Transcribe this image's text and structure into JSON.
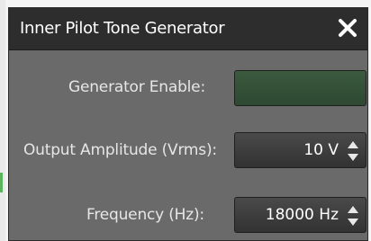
{
  "dialog": {
    "title": "Inner Pilot Tone Generator"
  },
  "fields": {
    "generator_enable": {
      "label": "Generator Enable:"
    },
    "output_amplitude": {
      "label": "Output Amplitude (Vrms):",
      "value": "10 V"
    },
    "frequency": {
      "label": "Frequency (Hz):",
      "value": "18000 Hz"
    }
  },
  "icons": {
    "close": "close-icon",
    "spinner": "spinner-arrows-icon"
  },
  "colors": {
    "dialog_bg": "#6a6a6a",
    "titlebar_bg": "#2d2d2d",
    "toggle_off_green": "#3b5a3e",
    "text": "#ffffff"
  }
}
